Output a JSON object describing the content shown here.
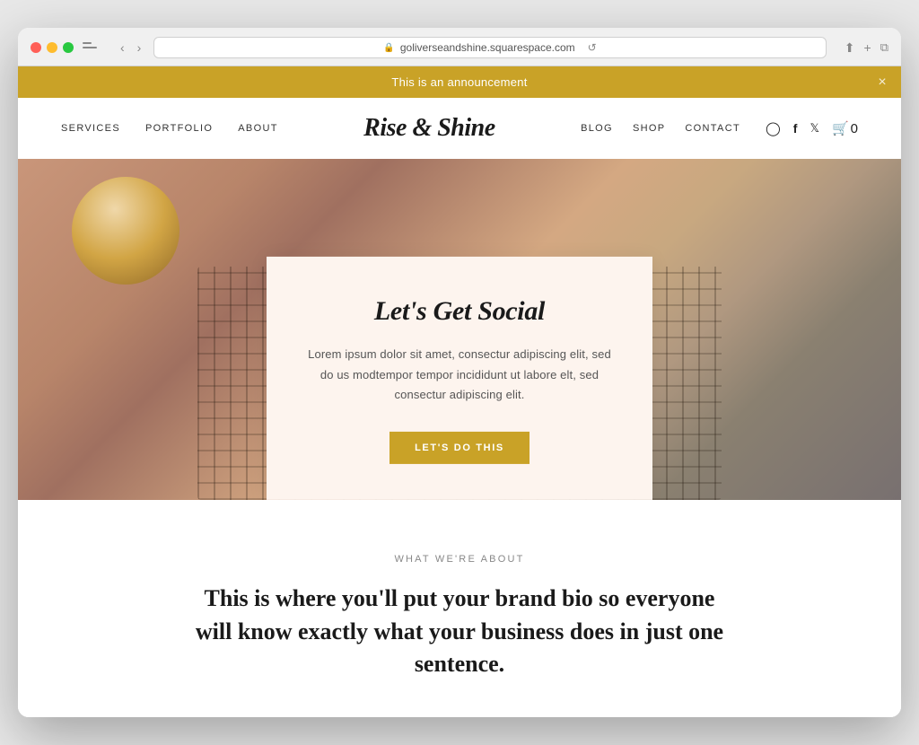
{
  "browser": {
    "url": "goliverseandshine.squarespace.com",
    "reload_label": "↺"
  },
  "announcement": {
    "text": "This is an announcement",
    "close_label": "×"
  },
  "nav": {
    "logo": "Rise & Shine",
    "left_links": [
      {
        "label": "SERVICES",
        "href": "#"
      },
      {
        "label": "PORTFOLIO",
        "href": "#"
      },
      {
        "label": "ABOUT",
        "href": "#"
      }
    ],
    "right_links": [
      {
        "label": "BLOG",
        "href": "#"
      },
      {
        "label": "SHOP",
        "href": "#"
      },
      {
        "label": "CONTACT",
        "href": "#"
      }
    ],
    "cart_count": "0"
  },
  "hero": {
    "card": {
      "title": "Let's Get Social",
      "text": "Lorem ipsum dolor sit amet, consectur adipiscing elit, sed do us modtempor tempor incididunt ut labore elt, sed consectur adipiscing elit.",
      "button_label": "LET'S DO THIS"
    }
  },
  "about": {
    "label": "WHAT WE'RE ABOUT",
    "title": "This is where you'll put your brand bio so everyone will know exactly what your business does in just one sentence."
  }
}
